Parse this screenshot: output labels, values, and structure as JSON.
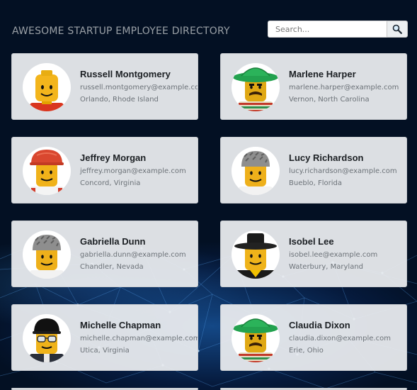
{
  "header": {
    "title": "AWESOME STARTUP EMPLOYEE DIRECTORY",
    "search_placeholder": "Search...",
    "search_icon": "magnifier-icon"
  },
  "employees": [
    {
      "name": "Russell Montgomery",
      "email": "russell.montgomery@example.com",
      "location": "Orlando, Rhode Island",
      "avatar": "lego-plain-red-shirt"
    },
    {
      "name": "Marlene Harper",
      "email": "marlene.harper@example.com",
      "location": "Vernon, North Carolina",
      "avatar": "lego-sombrero-mustache"
    },
    {
      "name": "Jeffrey Morgan",
      "email": "jeffrey.morgan@example.com",
      "location": "Concord, Virginia",
      "avatar": "lego-red-hardhat"
    },
    {
      "name": "Lucy Richardson",
      "email": "lucy.richardson@example.com",
      "location": "Bueblo, Florida",
      "avatar": "lego-gray-cap"
    },
    {
      "name": "Gabriella Dunn",
      "email": "gabriella.dunn@example.com",
      "location": "Chandler, Nevada",
      "avatar": "lego-gray-cap"
    },
    {
      "name": "Isobel Lee",
      "email": "isobel.lee@example.com",
      "location": "Waterbury, Maryland",
      "avatar": "lego-black-hat"
    },
    {
      "name": "Michelle Chapman",
      "email": "michelle.chapman@example.com",
      "location": "Utica, Virginia",
      "avatar": "lego-sunglasses"
    },
    {
      "name": "Claudia Dixon",
      "email": "claudia.dixon@example.com",
      "location": "Erie, Ohio",
      "avatar": "lego-sombrero-mustache"
    }
  ]
}
